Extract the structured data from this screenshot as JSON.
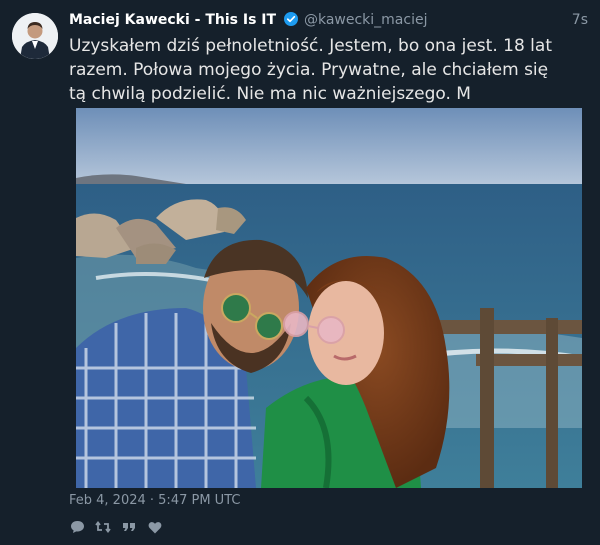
{
  "tweet": {
    "author_name": "Maciej Kawecki - This Is IT",
    "handle": "@kawecki_maciej",
    "relative_time": "7s",
    "text": "Uzyskałem dziś pełnoletniość. Jestem, bo ona jest. 18 lat razem. Połowa mojego życia. Prywatne, ale chciałem się tą chwilą podzielić. Nie ma nic ważniejszego. M",
    "date": "Feb 4, 2024 · 5:47 PM UTC",
    "verified": true
  },
  "icons": {
    "verified": "verified-badge-icon",
    "reply": "comment-icon",
    "retweet": "retweet-icon",
    "quote": "quote-icon",
    "like": "heart-icon"
  },
  "colors": {
    "background": "#15202b",
    "verified": "#1d9bf0",
    "muted": "#8b98a5"
  }
}
